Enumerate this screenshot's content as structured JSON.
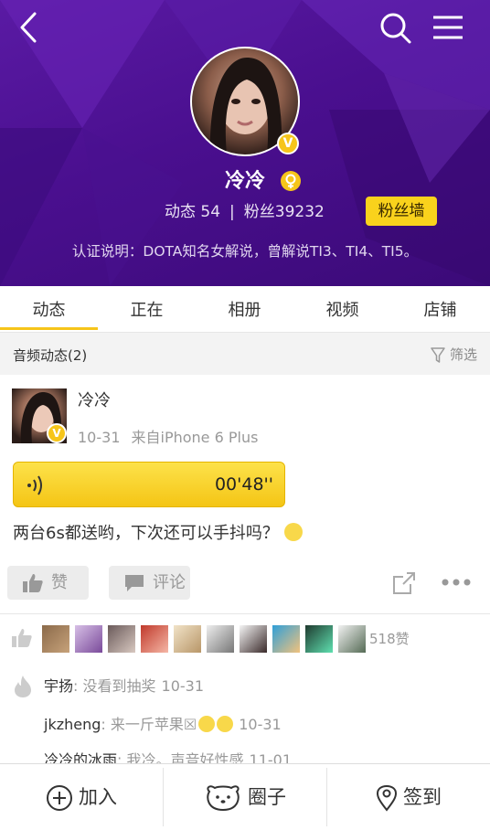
{
  "profile": {
    "name": "冷冷",
    "posts_label": "动态 54",
    "fans_label": "粉丝39232",
    "separator": "|",
    "fan_wall_label": "粉丝墙",
    "certification": "认证说明：DOTA知名女解说，曾解说TI3、TI4、TI5。",
    "verified_badge": "V",
    "gender_icon": "female-icon",
    "header_color": "#4e1496"
  },
  "tabs": [
    {
      "label": "动态",
      "active": true
    },
    {
      "label": "正在",
      "active": false
    },
    {
      "label": "相册",
      "active": false
    },
    {
      "label": "视频",
      "active": false
    },
    {
      "label": "店铺",
      "active": false
    }
  ],
  "section": {
    "title": "音频动态(2)",
    "filter_label": "筛选"
  },
  "post": {
    "author": "冷冷",
    "date": "10-31",
    "source": "来自iPhone 6 Plus",
    "audio_duration": "00'48''",
    "text": "两台6s都送哟，下次还可以手抖吗？",
    "like_label": "赞",
    "comment_label": "评论"
  },
  "likes": {
    "count_label": "518赞",
    "avatar_count": 10
  },
  "comments": [
    {
      "user": "宇扬",
      "text": "没看到抽奖",
      "time": "10-31"
    },
    {
      "user": "jkzheng",
      "text": "来一斤苹果☒",
      "time": "10-31"
    },
    {
      "user": "冷冷的冰雨",
      "text": "我冷。声音好性感",
      "time": "11-01"
    }
  ],
  "bottom_bar": {
    "join_label": "加入",
    "circle_label": "圈子",
    "checkin_label": "签到"
  },
  "accent_color": "#f6c51a"
}
